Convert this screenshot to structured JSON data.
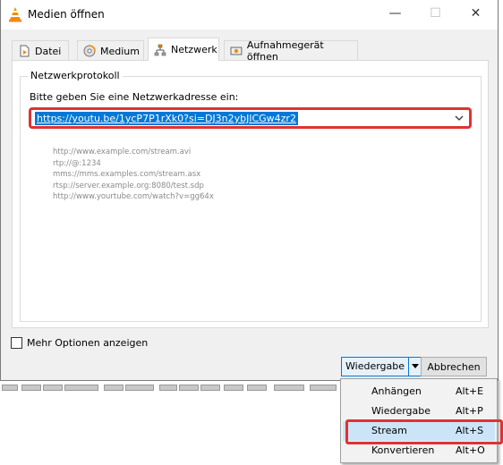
{
  "window": {
    "title": "Medien öffnen",
    "controls": {
      "minimize": "—",
      "maximize": "☐",
      "close": "✕"
    }
  },
  "tabs": [
    {
      "label": "Datei",
      "icon": "file-icon",
      "active": false
    },
    {
      "label": "Medium",
      "icon": "disc-icon",
      "active": false
    },
    {
      "label": "Netzwerk",
      "icon": "network-icon",
      "active": true
    },
    {
      "label": "Aufnahmegerät öffnen",
      "icon": "capture-device-icon",
      "active": false
    }
  ],
  "network": {
    "group_title": "Netzwerkprotokoll",
    "prompt": "Bitte geben Sie eine Netzwerkadresse ein:",
    "url_value": "https://youtu.be/1ycP7P1rXk0?si=DJ3n2ybJlCGw4zr2",
    "examples": [
      "http://www.example.com/stream.avi",
      "rtp://@:1234",
      "mms://mms.examples.com/stream.asx",
      "rtsp://server.example.org:8080/test.sdp",
      "http://www.yourtube.com/watch?v=gg64x"
    ]
  },
  "options": {
    "more_options_label": "Mehr Optionen anzeigen",
    "checked": false
  },
  "buttons": {
    "play_label": "Wiedergabe",
    "cancel_label": "Abbrechen"
  },
  "menu": {
    "items": [
      {
        "label": "Anhängen",
        "shortcut": "Alt+E"
      },
      {
        "label": "Wiedergabe",
        "shortcut": "Alt+P"
      },
      {
        "label": "Stream",
        "shortcut": "Alt+S",
        "highlighted": true
      },
      {
        "label": "Konvertieren",
        "shortcut": "Alt+O"
      }
    ]
  },
  "colors": {
    "accent": "#0078d7",
    "highlight_border": "#e03232",
    "vlc_orange": "#f28b00"
  }
}
